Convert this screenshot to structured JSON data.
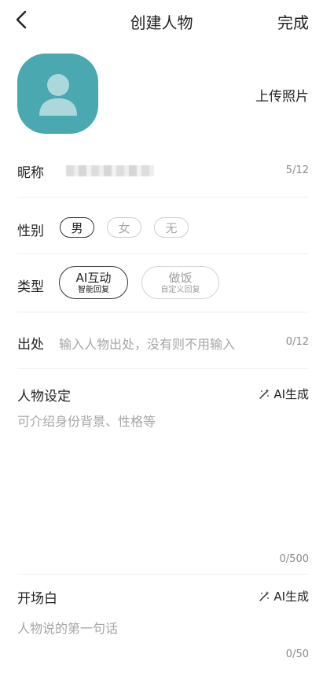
{
  "header": {
    "title": "创建人物",
    "done_label": "完成"
  },
  "avatar": {
    "upload_label": "上传照片",
    "icon": "person-icon",
    "color": "#4aa8b0"
  },
  "nickname": {
    "label": "昵称",
    "counter": "5/12"
  },
  "gender": {
    "label": "性别",
    "options": [
      "男",
      "女",
      "无"
    ],
    "selected": "男"
  },
  "type": {
    "label": "类型",
    "options": [
      {
        "title": "AI互动",
        "subtitle": "智能回复"
      },
      {
        "title": "做饭",
        "subtitle": "自定义回复"
      }
    ],
    "selected": "AI互动"
  },
  "source": {
    "label": "出处",
    "placeholder": "输入人物出处，没有则不用输入",
    "counter": "0/12"
  },
  "persona": {
    "label": "人物设定",
    "ai_label": "AI生成",
    "placeholder": "可介绍身份背景、性格等",
    "counter": "0/500"
  },
  "opening": {
    "label": "开场白",
    "ai_label": "AI生成",
    "placeholder": "人物说的第一句话",
    "counter": "0/50"
  }
}
